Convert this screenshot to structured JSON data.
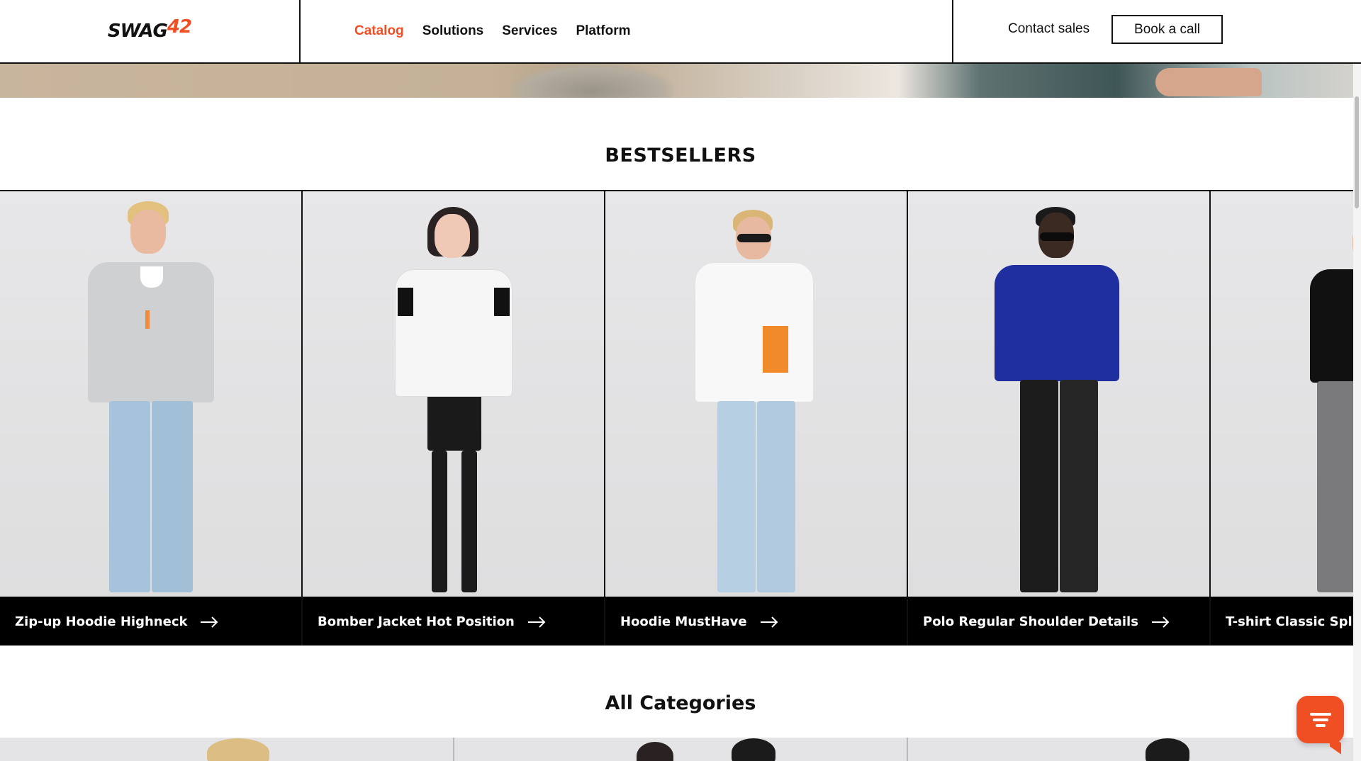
{
  "header": {
    "logo_main": "SWAG",
    "logo_number": "42",
    "nav": [
      {
        "label": "Catalog",
        "active": true
      },
      {
        "label": "Solutions",
        "active": false
      },
      {
        "label": "Services",
        "active": false
      },
      {
        "label": "Platform",
        "active": false
      }
    ],
    "contact_label": "Contact sales",
    "book_label": "Book a call"
  },
  "bestsellers": {
    "title": "BESTSELLERS",
    "products": [
      {
        "name": "Zip-up Hoodie Highneck"
      },
      {
        "name": "Bomber Jacket Hot Position"
      },
      {
        "name": "Hoodie MustHave"
      },
      {
        "name": "Polo Regular Shoulder Details"
      },
      {
        "name": "T-shirt Classic Split"
      }
    ]
  },
  "categories": {
    "title": "All Categories"
  },
  "colors": {
    "accent": "#f04e23",
    "text": "#111111",
    "card_bar": "#000000",
    "card_bg": "#e4e3e5"
  },
  "icons": {
    "arrow": "arrow-right-icon",
    "chat": "chat-icon"
  }
}
